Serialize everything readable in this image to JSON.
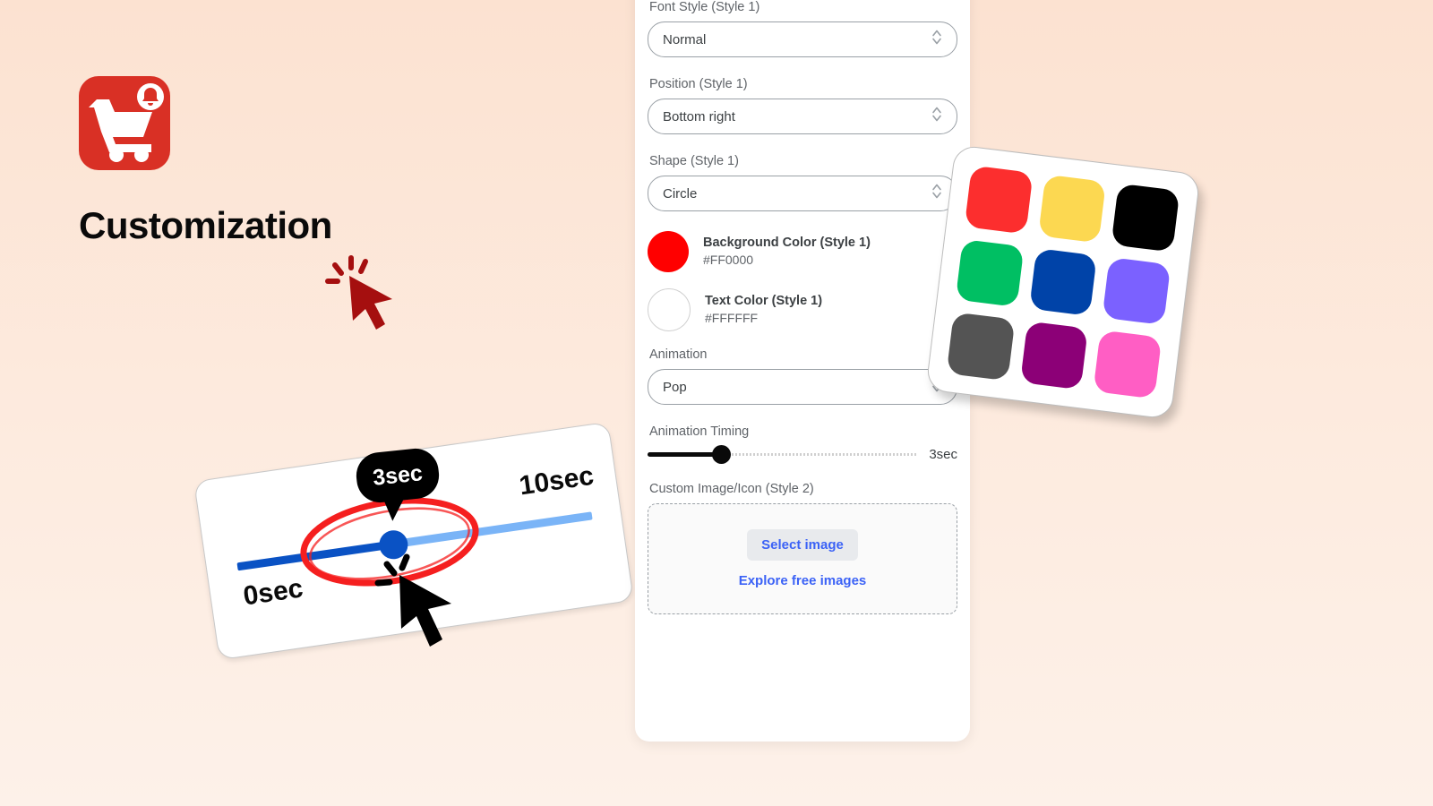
{
  "promo": {
    "title": "Customization",
    "app_icon_name": "shopping-cart-notification-icon",
    "icon_bg_color": "#D93025"
  },
  "timeline": {
    "min_label": "0sec",
    "max_label": "10sec",
    "tooltip": "3sec",
    "track_filled_color": "#0A52C4",
    "track_remaining_color": "#7AB4F7",
    "knob_color": "#0A52C4",
    "highlight_color": "#FF2D2D"
  },
  "panel": {
    "fields": [
      {
        "label": "Font Style (Style 1)",
        "value": "Normal"
      },
      {
        "label": "Position (Style 1)",
        "value": "Bottom right"
      },
      {
        "label": "Shape (Style 1)",
        "value": "Circle"
      }
    ],
    "colors": [
      {
        "label": "Background Color (Style 1)",
        "hex": "#FF0000"
      },
      {
        "label": "Text Color (Style 1)",
        "hex": "#FFFFFF"
      }
    ],
    "animation": {
      "label": "Animation",
      "value": "Pop"
    },
    "animation_timing": {
      "label": "Animation Timing",
      "value": "3sec",
      "percent": 27
    },
    "custom_image": {
      "label": "Custom Image/Icon (Style 2)",
      "select_button": "Select image",
      "explore_link": "Explore free images",
      "link_color": "#3B62F6"
    }
  },
  "palette": {
    "swatches": [
      "#FC2E2E",
      "#FCD851",
      "#000000",
      "#00BF63",
      "#0043A8",
      "#7B61FF",
      "#545454",
      "#8C0077",
      "#FF5EC4"
    ]
  }
}
